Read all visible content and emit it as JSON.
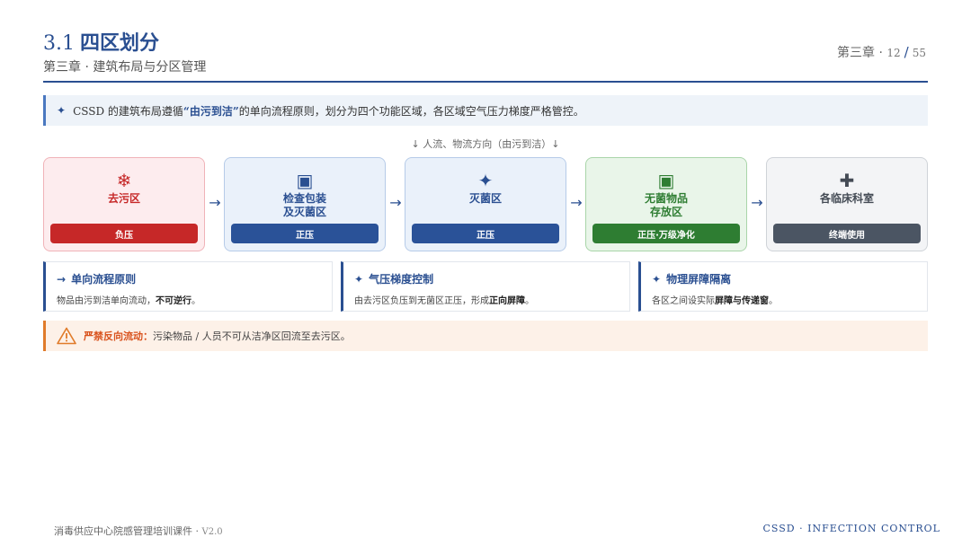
{
  "header": {
    "section_number": "3.1",
    "title": "四区划分",
    "subtitle": "第三章 · 建筑布局与分区管理",
    "chapter_label": "第三章 ·",
    "current_page": "12",
    "separator": "/",
    "total_pages": "55"
  },
  "intro": {
    "star": "✦",
    "text_before": "CSSD 的建筑布局遵循",
    "highlight": "“由污到洁”",
    "text_after": "的单向流程原则，划分为四个功能区域，各区域空气压力梯度严格管控。"
  },
  "flow_direction": "↓ 人流、物流方向（由污到洁）↓",
  "zones": [
    {
      "icon": "❄",
      "name": "去污区",
      "badge": "负压"
    },
    {
      "icon": "▣",
      "name": "检查包装\n及灭菌区",
      "badge": "正压"
    },
    {
      "icon": "✦",
      "name": "灭菌区",
      "badge": "正压"
    },
    {
      "icon": "▣",
      "name": "无菌物品\n存放区",
      "badge": "正压·万级净化"
    },
    {
      "icon": "✚",
      "name": "各临床科室",
      "badge": "终端使用"
    }
  ],
  "zone_arrow": "→",
  "cards": [
    {
      "icon": "→",
      "title": "单向流程原则",
      "body_before": "物品由污到洁单向流动，",
      "body_bold": "不可逆行",
      "body_after": "。"
    },
    {
      "icon": "✦",
      "title": "气压梯度控制",
      "body_before": "由去污区负压到无菌区正压，形成",
      "body_bold": "正向屏障",
      "body_after": "。"
    },
    {
      "icon": "✦",
      "title": "物理屏障隔离",
      "body_before": "各区之间设实际",
      "body_bold": "屏障与传递窗",
      "body_after": "。"
    }
  ],
  "warning": {
    "label": "严禁反向流动：",
    "text": "污染物品 / 人员不可从洁净区回流至去污区。"
  },
  "footer": {
    "left_text": "消毒供应中心院感管理培训课件 ·",
    "version": "V2.0",
    "right_text": "CSSD · INFECTION CONTROL"
  },
  "colors": {
    "primary_blue": "#2a4f91",
    "zone_red": "#c62828",
    "zone_blue": "#2a5298",
    "zone_green": "#2e7d32",
    "zone_gray": "#4b5563",
    "warning_orange": "#e07b2a"
  },
  "icons": {
    "zone_1": "snowflake-icon",
    "zone_2": "framed-square-icon",
    "zone_3": "sparkle-icon",
    "zone_4": "framed-square-icon",
    "zone_5": "cross-icon",
    "warning": "warning-triangle-icon"
  }
}
